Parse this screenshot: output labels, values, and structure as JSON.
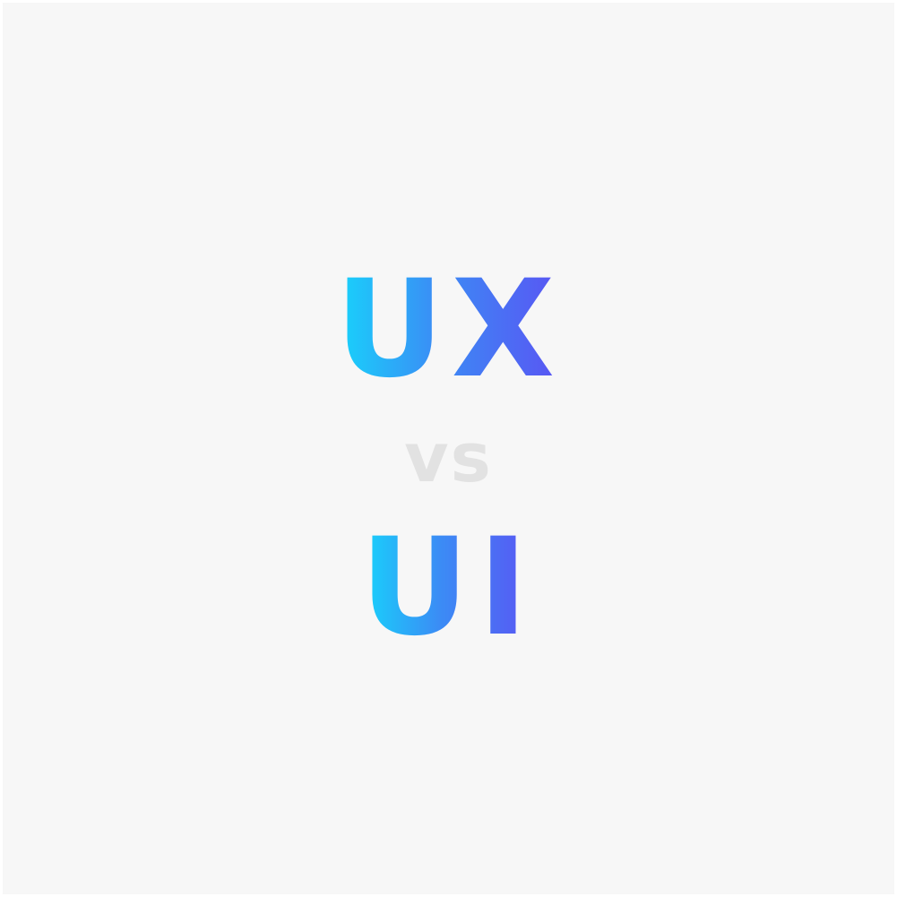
{
  "top_word": "UX",
  "separator": "vs",
  "bottom_word": "UI",
  "colors": {
    "background": "#f7f7f7",
    "gradient_start": "#17d4fb",
    "gradient_end": "#5a54f3",
    "separator": "#e2e2e2"
  }
}
